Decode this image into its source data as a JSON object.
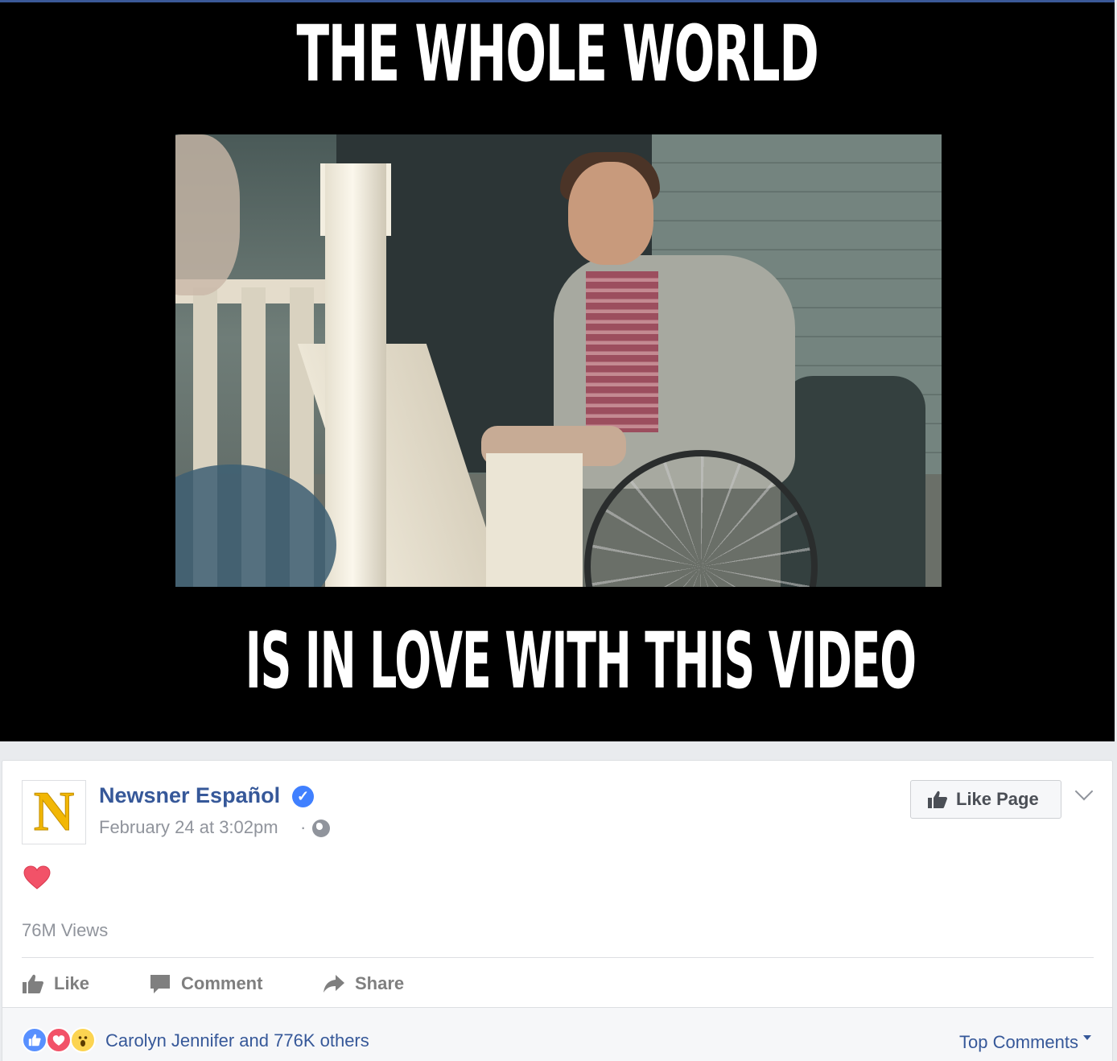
{
  "video": {
    "caption_top": "THE WHOLE WORLD",
    "caption_bottom": "IS IN LOVE WITH THIS VIDEO"
  },
  "post": {
    "avatar_letter": "N",
    "page_name": "Newsner Español",
    "date": "February 24 at 3:02pm",
    "date_separator": "·",
    "verified_glyph": "✓",
    "like_page_label": "Like Page",
    "views": "76M Views"
  },
  "actions": {
    "like_label": "Like",
    "comment_label": "Comment",
    "share_label": "Share"
  },
  "reactions": {
    "summary_text": "Carolyn Jennifer and 776K others",
    "top_comments_label": "Top Comments",
    "types": [
      "like",
      "love",
      "wow"
    ]
  },
  "icons": {
    "verified": "verified-badge-icon",
    "globe": "globe-icon",
    "thumb": "thumbs-up-icon",
    "chevron": "chevron-down-icon",
    "heart": "heart-icon",
    "comment": "comment-bubble-icon",
    "share": "share-arrow-icon"
  },
  "colors": {
    "link_blue": "#365899",
    "muted_gray": "#90949c",
    "like_blue": "#5890ff",
    "love_red": "#f25268",
    "wow_yellow": "#fcd451",
    "brand_yellow": "#f2b705"
  }
}
